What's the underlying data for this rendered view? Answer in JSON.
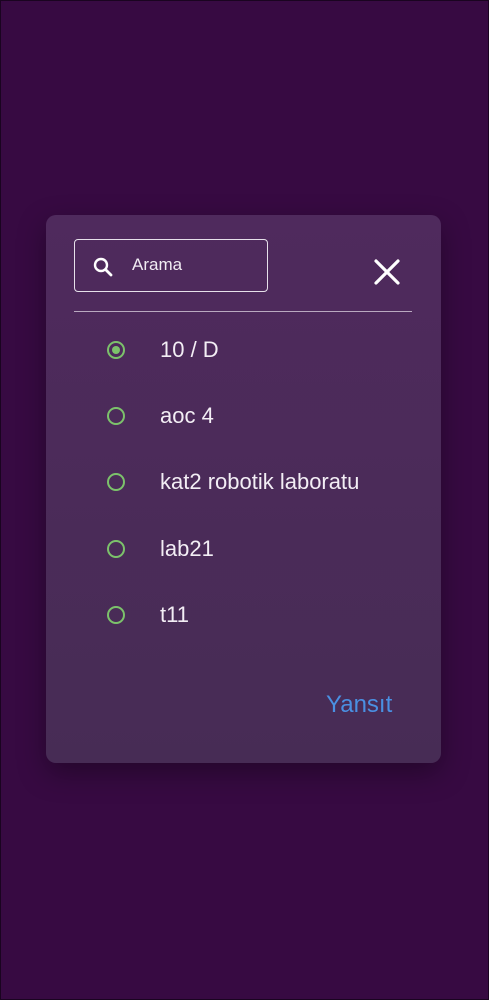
{
  "dialog": {
    "search": {
      "placeholder": "Arama"
    },
    "options": [
      {
        "label": "10 / D",
        "selected": true
      },
      {
        "label": "aoc 4",
        "selected": false
      },
      {
        "label": "kat2 robotik laboratu",
        "selected": false
      },
      {
        "label": "lab21",
        "selected": false
      },
      {
        "label": "t11",
        "selected": false
      }
    ],
    "apply_label": "Yansıt"
  },
  "colors": {
    "background": "#370a42",
    "dialog": "#4b2b59",
    "radio": "#7cc26b",
    "link": "#4a90e2"
  },
  "icons": {
    "search": "search-icon",
    "close": "close-icon"
  }
}
